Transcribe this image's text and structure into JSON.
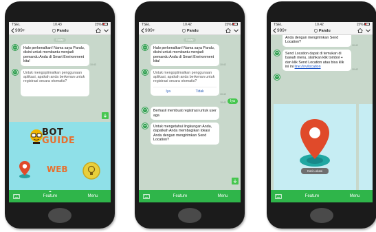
{
  "status": {
    "carrier": "TSEL",
    "time_1": "10.43",
    "time_2": "10.42",
    "time_3": "10.42",
    "battery": "15%"
  },
  "header": {
    "back_count": "999+",
    "title": "Pandu"
  },
  "day_label": "Today",
  "bottom_bar": {
    "feature": "Feature",
    "menu": "Menu"
  },
  "messages": {
    "greeting": "Halo perkenalkan! Nama saya Pandu, disini untuk membantu menjadi pemandu Anda di Smart Environment kita!",
    "optimize": "Untuk mengoptimalkan penggunaan aplikasi, apakah anda berkenan untuk registrasi secara otomatis?",
    "choice_yes": "Iya",
    "choice_no": "Tidak",
    "reply_yes": "Iya",
    "registered": "Berhasil membuat registrasi untuk user aga",
    "env_info": "Untuk mengetahui lingkungan Anda, dapatkah Anda membagikan lokasi Anda dengan mengirimkan Send Location?",
    "env_info_tail": "Anda dengan mengirimkan Send Location?",
    "send_location_prefix": "Send Location dapat di temukan di bawah menu, silahkan klik tombol + dan klik Send Location atau bisa klik ini ini ",
    "send_location_link": "line://nv/location",
    "time_a": "10:43",
    "time_b": "10:42"
  },
  "rich_menu": {
    "title_1": "BOT",
    "title_2": "GUIDE",
    "web": "WEB"
  },
  "carousel": {
    "send_button": "Cari Lokasi"
  },
  "colors": {
    "line_green": "#2fb54a",
    "chat_bg": "#c8d8cb",
    "panel_cyan": "#8fe0e8",
    "accent_orange": "#e7702f"
  }
}
